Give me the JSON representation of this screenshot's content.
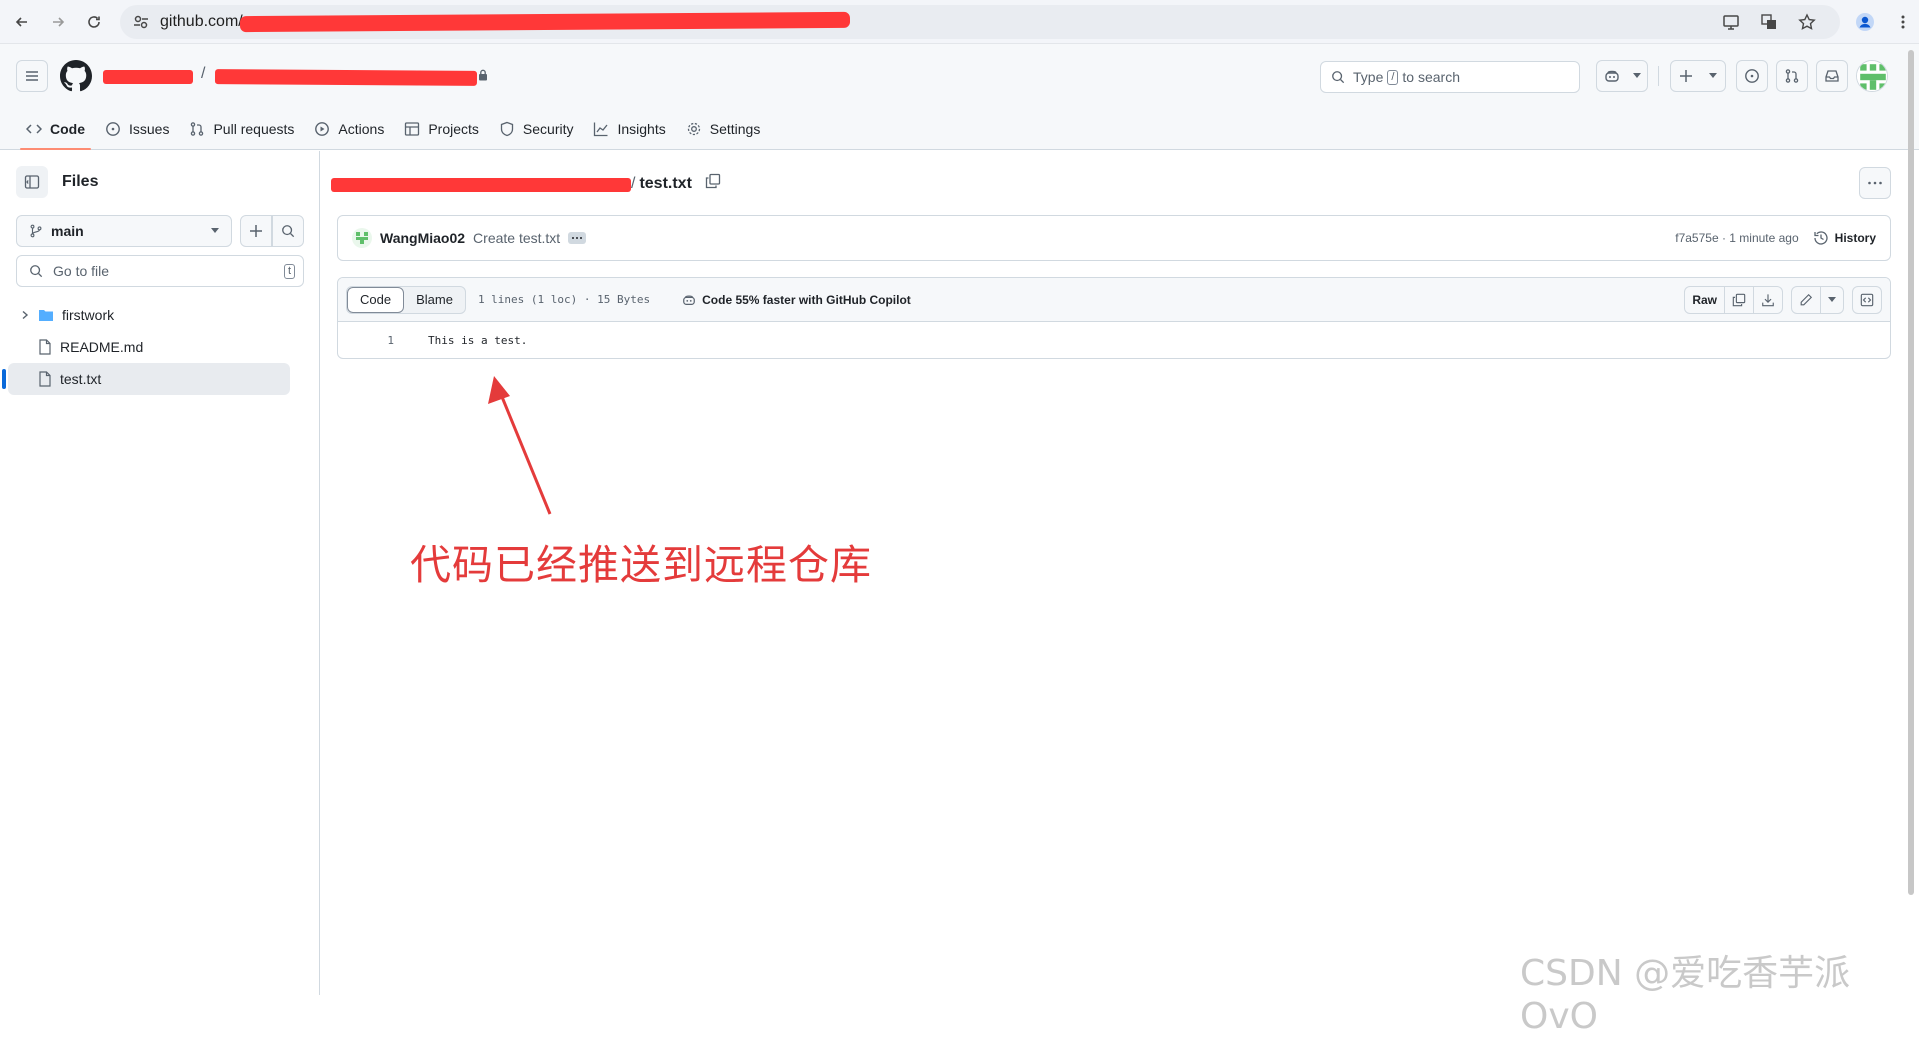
{
  "browser": {
    "url": "github.com/"
  },
  "header": {
    "search_label": "Type",
    "search_key": "/",
    "search_suffix": "to search",
    "tabs": [
      {
        "label": "Code"
      },
      {
        "label": "Issues"
      },
      {
        "label": "Pull requests"
      },
      {
        "label": "Actions"
      },
      {
        "label": "Projects"
      },
      {
        "label": "Security"
      },
      {
        "label": "Insights"
      },
      {
        "label": "Settings"
      }
    ]
  },
  "sidebar": {
    "title": "Files",
    "branch": "main",
    "goto_placeholder": "Go to file",
    "goto_key": "t",
    "tree": [
      {
        "label": "firstwork",
        "type": "folder"
      },
      {
        "label": "README.md",
        "type": "file"
      },
      {
        "label": "test.txt",
        "type": "file"
      }
    ]
  },
  "main": {
    "file_name": "test.txt",
    "path_separator": "/",
    "commit": {
      "author": "WangMiao02",
      "message": "Create test.txt",
      "hash_time": "f7a575e · 1 minute ago",
      "history_label": "History"
    },
    "file": {
      "tab_code": "Code",
      "tab_blame": "Blame",
      "meta": "1 lines (1 loc) · 15 Bytes",
      "copilot": "Code 55% faster with GitHub Copilot",
      "raw_label": "Raw",
      "lines": [
        {
          "number": "1",
          "text": "This is a test."
        }
      ]
    }
  },
  "annotation": {
    "text": "代码已经推送到远程仓库",
    "color": "#e43b3b"
  },
  "watermark": "CSDN @爱吃香芋派OvO",
  "colors": {
    "accent_tab": "#fd8c73",
    "selection_bar": "#0969da",
    "redaction": "#ff3838"
  }
}
